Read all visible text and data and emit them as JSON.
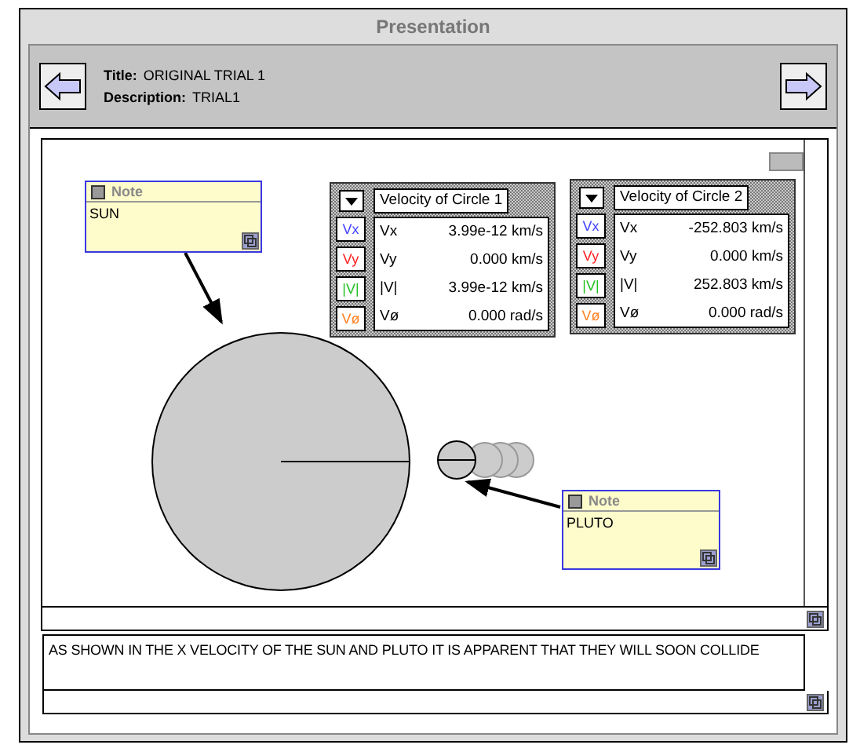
{
  "window": {
    "title": "Presentation"
  },
  "header": {
    "title_label": "Title:",
    "title_value": "ORIGINAL TRIAL 1",
    "description_label": "Description:",
    "description_value": "TRIAL1"
  },
  "notes": [
    {
      "title": "Note",
      "text": "SUN"
    },
    {
      "title": "Note",
      "text": "PLUTO"
    }
  ],
  "meters": [
    {
      "title": "Velocity of Circle 1",
      "rows": [
        {
          "badge": "Vx",
          "label": "Vx",
          "value": "3.99e-12 km/s",
          "color": "#4040ff"
        },
        {
          "badge": "Vy",
          "label": "Vy",
          "value": "0.000 km/s",
          "color": "#ff2020"
        },
        {
          "badge": "|V|",
          "label": "|V|",
          "value": "3.99e-12 km/s",
          "color": "#20c020"
        },
        {
          "badge": "Vø",
          "label": "Vø",
          "value": "0.000 rad/s",
          "color": "#ff8020"
        }
      ]
    },
    {
      "title": "Velocity of Circle 2",
      "rows": [
        {
          "badge": "Vx",
          "label": "Vx",
          "value": "-252.803 km/s",
          "color": "#4040ff"
        },
        {
          "badge": "Vy",
          "label": "Vy",
          "value": "0.000 km/s",
          "color": "#ff2020"
        },
        {
          "badge": "|V|",
          "label": "|V|",
          "value": "252.803 km/s",
          "color": "#20c020"
        },
        {
          "badge": "Vø",
          "label": "Vø",
          "value": "0.000 rad/s",
          "color": "#ff8020"
        }
      ]
    }
  ],
  "narration": "AS SHOWN IN THE X VELOCITY OF THE SUN AND PLUTO IT IS APPARENT THAT THEY WILL SOON COLLIDE"
}
